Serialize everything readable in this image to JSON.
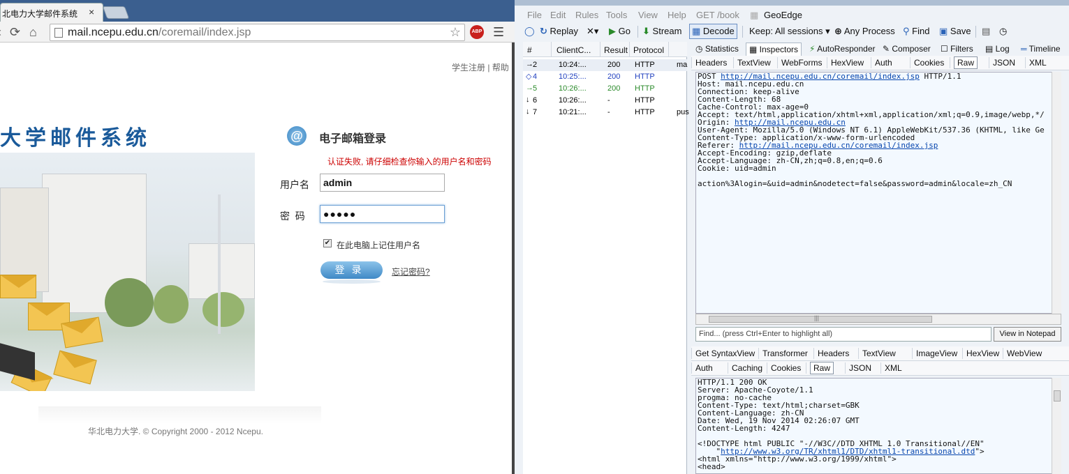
{
  "chrome": {
    "tab_title": "北电力大学邮件系统",
    "tab_close": "×",
    "url_host": "mail.ncepu.edu.cn",
    "url_path": "/coremail/index.jsp",
    "abp_label": "ABP",
    "icons": {
      "reload": "reload-icon",
      "home": "home-icon",
      "star": "star-icon",
      "menu": "menu-icon"
    }
  },
  "mail_page": {
    "top_links": [
      "学生注册",
      "帮助"
    ],
    "top_link_sep": "|",
    "brand_title": "大学邮件系统",
    "login_icon": "@",
    "login_heading": "电子邮箱登录",
    "error_message": "认证失败, 请仔细检查你输入的用户名和密码",
    "username_label": "用户名",
    "username_value": "admin",
    "password_label": "密  码",
    "password_value": "●●●●●",
    "remember_checked": true,
    "remember_label": "在此电脑上记住用户名",
    "login_button": "登录",
    "forgot_link": "忘记密码?",
    "copyright": "华北电力大学. © Copyright 2000 - 2012 Ncepu."
  },
  "fiddler": {
    "menu": [
      "File",
      "Edit",
      "Rules",
      "Tools",
      "View",
      "Help",
      "GET /book",
      "GeoEdge"
    ],
    "toolbar": {
      "replay": "Replay",
      "remove": "✕▾",
      "go": "Go",
      "stream": "Stream",
      "decode": "Decode",
      "keep": "Keep: All sessions ▾",
      "any_process": "Any Process",
      "find": "Find",
      "save": "Save"
    },
    "session_columns": [
      "#",
      "ClientC...",
      "Result",
      "Protocol"
    ],
    "sessions": [
      {
        "id": "2",
        "time": "10:24:...",
        "result": "200",
        "protocol": "HTTP",
        "host": "ma",
        "color": "#000000",
        "icon": "→"
      },
      {
        "id": "4",
        "time": "10:25:...",
        "result": "200",
        "protocol": "HTTP",
        "host": "",
        "color": "#1f3fbf",
        "icon": "◇"
      },
      {
        "id": "5",
        "time": "10:26:...",
        "result": "200",
        "protocol": "HTTP",
        "host": "",
        "color": "#2a8a2a",
        "icon": "→"
      },
      {
        "id": "6",
        "time": "10:26:...",
        "result": "-",
        "protocol": "HTTP",
        "host": "",
        "color": "#000000",
        "icon": "↓"
      },
      {
        "id": "7",
        "time": "10:21:...",
        "result": "-",
        "protocol": "HTTP",
        "host": "pus",
        "color": "#000000",
        "icon": "↓"
      }
    ],
    "inspector_tabs": [
      "Statistics",
      "Inspectors",
      "AutoResponder",
      "Composer",
      "Filters",
      "Log",
      "Timeline"
    ],
    "request_tabs": [
      "Headers",
      "TextView",
      "WebForms",
      "HexView",
      "Auth",
      "Cookies",
      "Raw",
      "JSON",
      "XML"
    ],
    "request_raw": [
      {
        "t": "POST ",
        "link": "http://mail.ncepu.edu.cn/coremail/index.jsp",
        "after": " HTTP/1.1"
      },
      {
        "t": "Host: mail.ncepu.edu.cn"
      },
      {
        "t": "Connection: keep-alive"
      },
      {
        "t": "Content-Length: 68"
      },
      {
        "t": "Cache-Control: max-age=0"
      },
      {
        "t": "Accept: text/html,application/xhtml+xml,application/xml;q=0.9,image/webp,*/"
      },
      {
        "t": "Origin: ",
        "link": "http://mail.ncepu.edu.cn",
        "after": ""
      },
      {
        "t": "User-Agent: Mozilla/5.0 (Windows NT 6.1) AppleWebKit/537.36 (KHTML, like Ge"
      },
      {
        "t": "Content-Type: application/x-www-form-urlencoded"
      },
      {
        "t": "Referer: ",
        "link": "http://mail.ncepu.edu.cn/coremail/index.jsp",
        "after": ""
      },
      {
        "t": "Accept-Encoding: gzip,deflate"
      },
      {
        "t": "Accept-Language: zh-CN,zh;q=0.8,en;q=0.6"
      },
      {
        "t": "Cookie: uid=admin"
      },
      {
        "t": ""
      },
      {
        "t": "action%3Alogin=&uid=admin&nodetect=false&password=admin&locale=zh_CN"
      }
    ],
    "scroll_grip": "|||",
    "find_placeholder": "Find... (press Ctrl+Enter to highlight all)",
    "view_notepad": "View in Notepad",
    "response_tabs_row1": [
      "Get SyntaxView",
      "Transformer",
      "Headers",
      "TextView",
      "ImageView",
      "HexView",
      "WebView"
    ],
    "response_tabs_row2": [
      "Auth",
      "Caching",
      "Cookies",
      "Raw",
      "JSON",
      "XML"
    ],
    "response_raw": [
      {
        "t": "HTTP/1.1 200 OK"
      },
      {
        "t": "Server: Apache-Coyote/1.1"
      },
      {
        "t": "progma: no-cache"
      },
      {
        "t": "Content-Type: text/html;charset=GBK"
      },
      {
        "t": "Content-Language: zh-CN"
      },
      {
        "t": "Date: Wed, 19 Nov 2014 02:26:07 GMT"
      },
      {
        "t": "Content-Length: 4247"
      },
      {
        "t": ""
      },
      {
        "t": "<!DOCTYPE html PUBLIC \"-//W3C//DTD XHTML 1.0 Transitional//EN\""
      },
      {
        "t": "    \"",
        "link": "http://www.w3.org/TR/xhtml1/DTD/xhtml1-transitional.dtd",
        "after": "\">"
      },
      {
        "t": "<html xmlns=\"http://www.w3.org/1999/xhtml\">"
      },
      {
        "t": "<head>"
      }
    ]
  }
}
